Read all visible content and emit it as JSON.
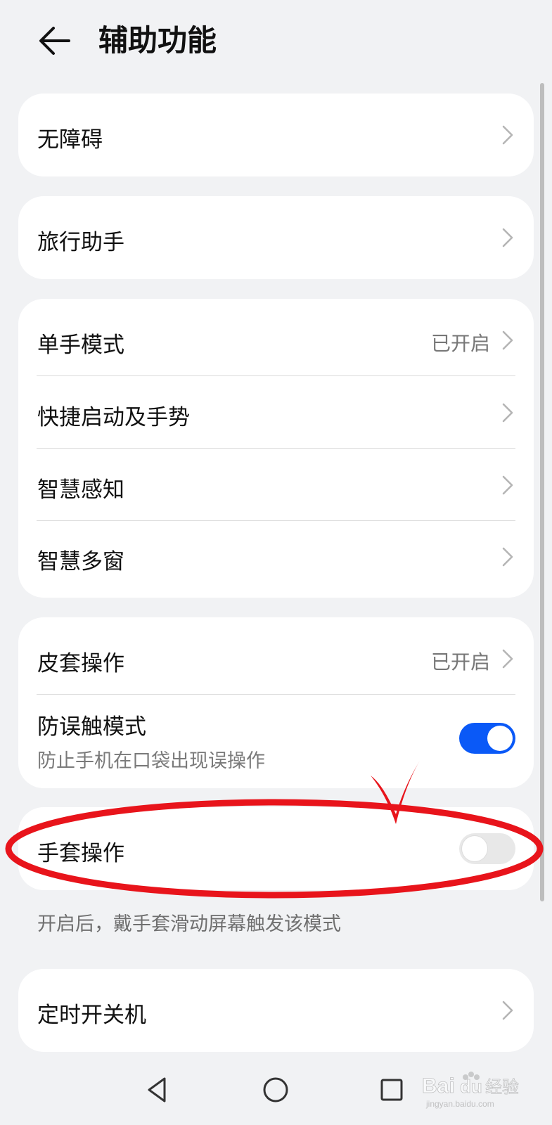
{
  "header": {
    "title": "辅助功能",
    "back_icon": "back-arrow-icon"
  },
  "groups": {
    "g1": {
      "item": {
        "label": "无障碍"
      }
    },
    "g2": {
      "item": {
        "label": "旅行助手"
      }
    },
    "g3": {
      "items": [
        {
          "label": "单手模式",
          "status": "已开启"
        },
        {
          "label": "快捷启动及手势"
        },
        {
          "label": "智慧感知"
        },
        {
          "label": "智慧多窗"
        }
      ]
    },
    "g4": {
      "items": [
        {
          "label": "皮套操作",
          "status": "已开启"
        },
        {
          "label": "防误触模式",
          "description": "防止手机在口袋出现误操作",
          "toggle_on": true
        }
      ]
    },
    "g5": {
      "item": {
        "label": "手套操作",
        "toggle_on": false
      }
    },
    "g5_footnote": "开启后，戴手套滑动屏幕触发该模式",
    "g6": {
      "item": {
        "label": "定时开关机"
      }
    }
  },
  "colors": {
    "accent": "#0a59f7",
    "annotation": "#e8141b",
    "background": "#f1f2f4"
  },
  "navbar": {
    "icons": [
      "back-triangle-icon",
      "home-circle-icon",
      "recents-square-icon"
    ]
  },
  "watermark": {
    "text": "Bai du 经验",
    "url_text": "jingyan.baidu.com"
  }
}
